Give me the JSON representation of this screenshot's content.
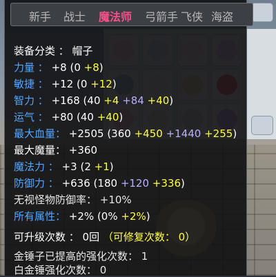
{
  "job_tabs": [
    "新手",
    "战士",
    "魔法师",
    "弓箭手",
    "飞侠",
    "海盗"
  ],
  "active_tab_index": 2,
  "colors": {
    "active_tab": "#ff4e8a",
    "stat_name_blue": "#54a6ff",
    "bonus_yellow": "#ffff45",
    "flame_purple": "#b8b1ff",
    "upgrade_green": "#a8ff88"
  },
  "tooltip": {
    "category": "装备分类 ： 帽子",
    "str": {
      "label": "力量 ：",
      "total": "+8",
      "open": "(0",
      "bonus": "+8",
      "close": ")"
    },
    "dex": {
      "label": "敏捷 ：",
      "total": "+12",
      "open": "(0",
      "bonus": "+12",
      "close": ")"
    },
    "int": {
      "label": "智力 ：",
      "total": "+168",
      "open": "(40",
      "bonus": "+4",
      "flame": "+84",
      "enhance": "+40",
      "close": ")"
    },
    "luk": {
      "label": "运气 ：",
      "total": "+80",
      "open": "(40",
      "bonus": "+40",
      "close": ")"
    },
    "hp": {
      "label": "最大血量：",
      "total": "+2505",
      "open": "(360",
      "bonus": "+450",
      "flame": "+1440",
      "enhance": "+255",
      "close": ")"
    },
    "mp": {
      "label": "最大魔量：",
      "total": "+360"
    },
    "matk": {
      "label": "魔法力 ：",
      "total": "+3",
      "open": "(2",
      "bonus": "+1",
      "close": ")"
    },
    "def": {
      "label": "防御力 ：",
      "total": "+636",
      "open": "(180",
      "flame": "+120",
      "enhance": "+336",
      "close": ")"
    },
    "ignore_def": "无视怪物防御率： +10%",
    "all_stat": {
      "label": "所有属性：",
      "total": "+2%",
      "open": "(0%",
      "bonus": "+2%",
      "close": ")"
    },
    "upgrades": {
      "text": "可升级次数 ： 0回",
      "repair": "（可修复次数： 0）"
    },
    "hammer_applied": "金锤子已提高的强化次数： 1",
    "hammer_platinum": "白金锤强化次数： 0"
  }
}
